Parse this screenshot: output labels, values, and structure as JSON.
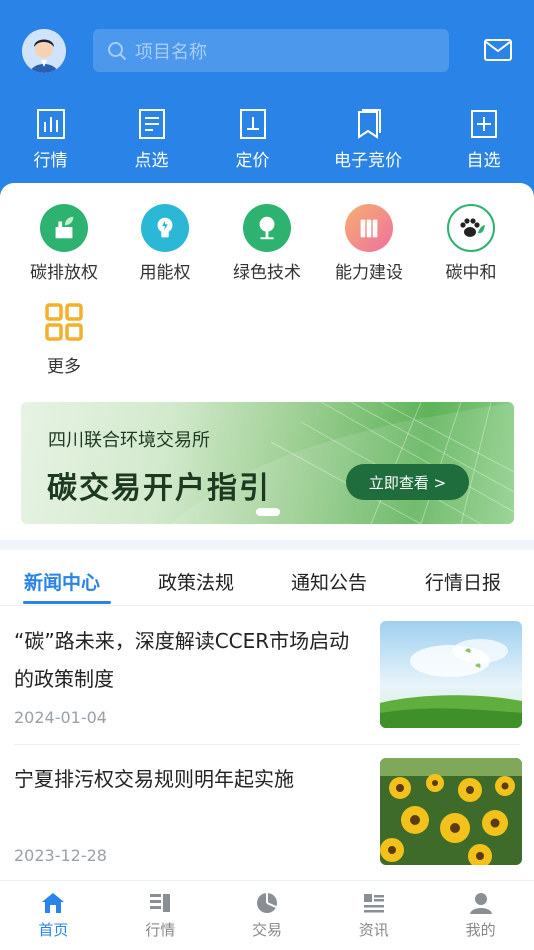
{
  "search": {
    "placeholder": "项目名称"
  },
  "top_nav": [
    {
      "label": "行情",
      "icon": "bar-chart-icon"
    },
    {
      "label": "点选",
      "icon": "document-list-icon"
    },
    {
      "label": "定价",
      "icon": "price-tag-icon"
    },
    {
      "label": "电子竞价",
      "icon": "bookmark-icon"
    },
    {
      "label": "自选",
      "icon": "plus-square-icon"
    }
  ],
  "categories": [
    {
      "label": "碳排放权",
      "icon": "factory-leaf-icon",
      "color": "#2db36f"
    },
    {
      "label": "用能权",
      "icon": "lightbulb-icon",
      "color": "#2bb7d6"
    },
    {
      "label": "绿色技术",
      "icon": "tree-icon",
      "color": "#2db36f"
    },
    {
      "label": "能力建设",
      "icon": "books-icon",
      "color": "#f08a5a"
    },
    {
      "label": "碳中和",
      "icon": "paw-leaf-icon",
      "color": "#333333"
    },
    {
      "label": "更多",
      "icon": "grid-icon",
      "color": "#f3b02a"
    }
  ],
  "banner": {
    "subtitle": "四川联合环境交易所",
    "title": "碳交易开户指引",
    "button": "立即查看 >"
  },
  "tabs": [
    "新闻中心",
    "政策法规",
    "通知公告",
    "行情日报"
  ],
  "news": [
    {
      "title": "“碳”路未来，深度解读CCER市场启动的政策制度",
      "date": "2024-01-04"
    },
    {
      "title": "宁夏排污权交易规则明年起实施",
      "date": "2023-12-28"
    }
  ],
  "bottom_tabs": [
    {
      "label": "首页",
      "icon": "home-icon",
      "active": true
    },
    {
      "label": "行情",
      "icon": "market-list-icon"
    },
    {
      "label": "交易",
      "icon": "pie-chart-icon"
    },
    {
      "label": "资讯",
      "icon": "news-icon"
    },
    {
      "label": "我的",
      "icon": "profile-icon"
    }
  ],
  "colors": {
    "primary": "#2a83e6",
    "banner_button": "#1f6d3c"
  }
}
